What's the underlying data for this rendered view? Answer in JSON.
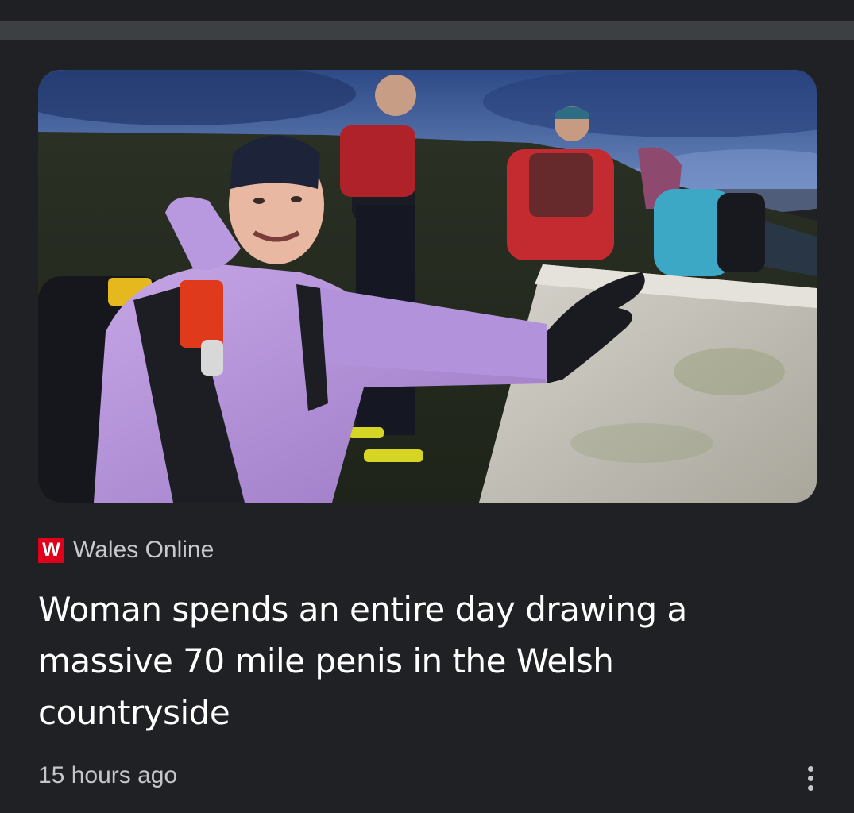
{
  "article": {
    "image_alt": "Woman in a lilac jacket smiling beside a trig point with other runners on a hilltop at dusk",
    "source": {
      "logo_letter": "W",
      "logo_color": "#e0001b",
      "name": "Wales Online"
    },
    "headline": "Woman spends an entire day drawing a massive 70 mile penis in the Welsh countryside",
    "timestamp": "15 hours ago",
    "more_icon": "more-vert-icon"
  },
  "colors": {
    "background": "#202124",
    "divider": "#3c4043",
    "headline": "#ffffff",
    "meta": "#c4c6c9"
  }
}
